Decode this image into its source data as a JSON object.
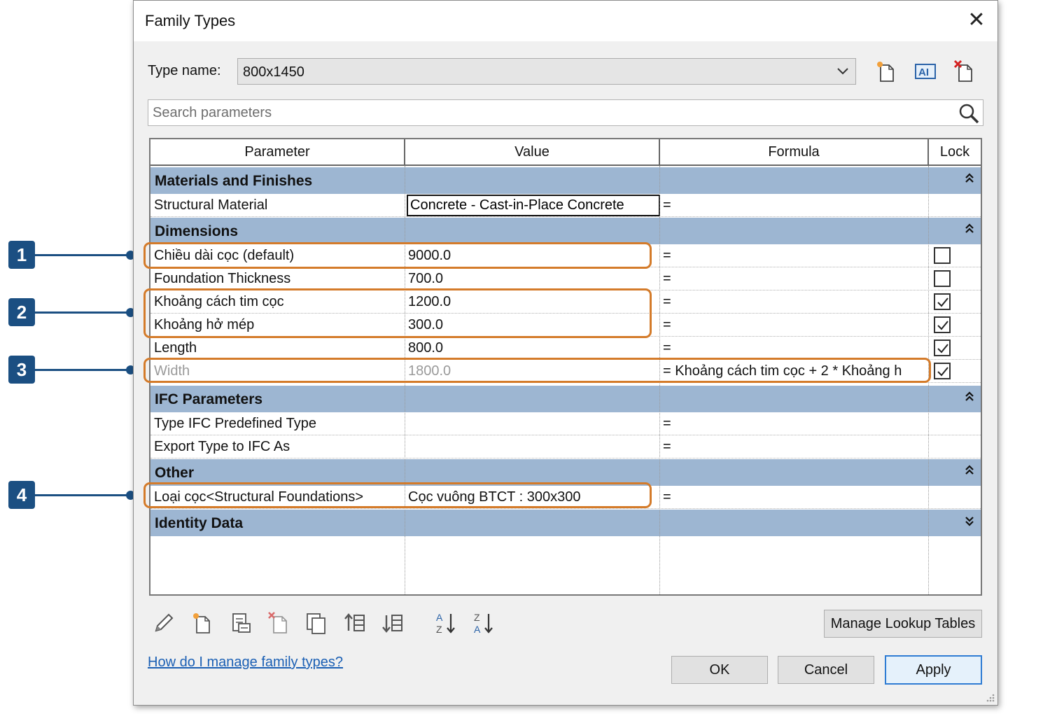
{
  "dialog": {
    "title": "Family Types",
    "close_glyph": "✕",
    "type_name_label": "Type name:",
    "type_name_value": "800x1450",
    "search_placeholder": "Search parameters"
  },
  "grid": {
    "headers": [
      "Parameter",
      "Value",
      "Formula",
      "Lock"
    ],
    "groups": [
      {
        "name": "Materials and Finishes",
        "expanded": true,
        "rows": [
          {
            "parameter": "Structural Material",
            "value": "Concrete - Cast-in-Place Concrete",
            "formula": "=",
            "lock": null
          }
        ]
      },
      {
        "name": "Dimensions",
        "expanded": true,
        "rows": [
          {
            "parameter": "Chiều dài cọc (default)",
            "value": "9000.0",
            "formula": "=",
            "lock": false
          },
          {
            "parameter": "Foundation Thickness",
            "value": "700.0",
            "formula": "=",
            "lock": false
          },
          {
            "parameter": "Khoảng cách tim cọc",
            "value": "1200.0",
            "formula": "=",
            "lock": true
          },
          {
            "parameter": "Khoảng hở mép",
            "value": "300.0",
            "formula": "=",
            "lock": true
          },
          {
            "parameter": "Length",
            "value": "800.0",
            "formula": "=",
            "lock": true
          },
          {
            "parameter": "Width",
            "value": "1800.0",
            "formula": "= Khoảng cách tim cọc + 2 * Khoảng h",
            "lock": true,
            "greyed": true
          }
        ]
      },
      {
        "name": "IFC Parameters",
        "expanded": true,
        "rows": [
          {
            "parameter": "Type IFC Predefined Type",
            "value": "",
            "formula": "=",
            "lock": null
          },
          {
            "parameter": "Export Type to IFC As",
            "value": "",
            "formula": "=",
            "lock": null
          }
        ]
      },
      {
        "name": "Other",
        "expanded": true,
        "rows": [
          {
            "parameter": "Loại cọc<Structural Foundations>",
            "value": "Cọc vuông BTCT : 300x300",
            "formula": "=",
            "lock": null
          }
        ]
      },
      {
        "name": "Identity Data",
        "expanded": false,
        "rows": []
      }
    ],
    "chevron_up": "⌃",
    "chevron_down": "⌄"
  },
  "toolbar_icons": [
    "edit-parameter-icon",
    "new-parameter-icon",
    "shared-parameter-icon",
    "delete-parameter-icon",
    "copy-parameter-icon",
    "move-up-icon",
    "move-down-icon",
    "sort-ascending-icon",
    "sort-descending-icon"
  ],
  "buttons": {
    "manage_lookup": "Manage Lookup Tables",
    "ok": "OK",
    "cancel": "Cancel",
    "apply": "Apply"
  },
  "help_link": "How do I manage family types?",
  "annotations": [
    "1",
    "2",
    "3",
    "4"
  ],
  "colors": {
    "group_band": "#9db6d2",
    "highlight": "#d47b2a",
    "badge": "#1b4f82",
    "link": "#1a5fb4"
  }
}
